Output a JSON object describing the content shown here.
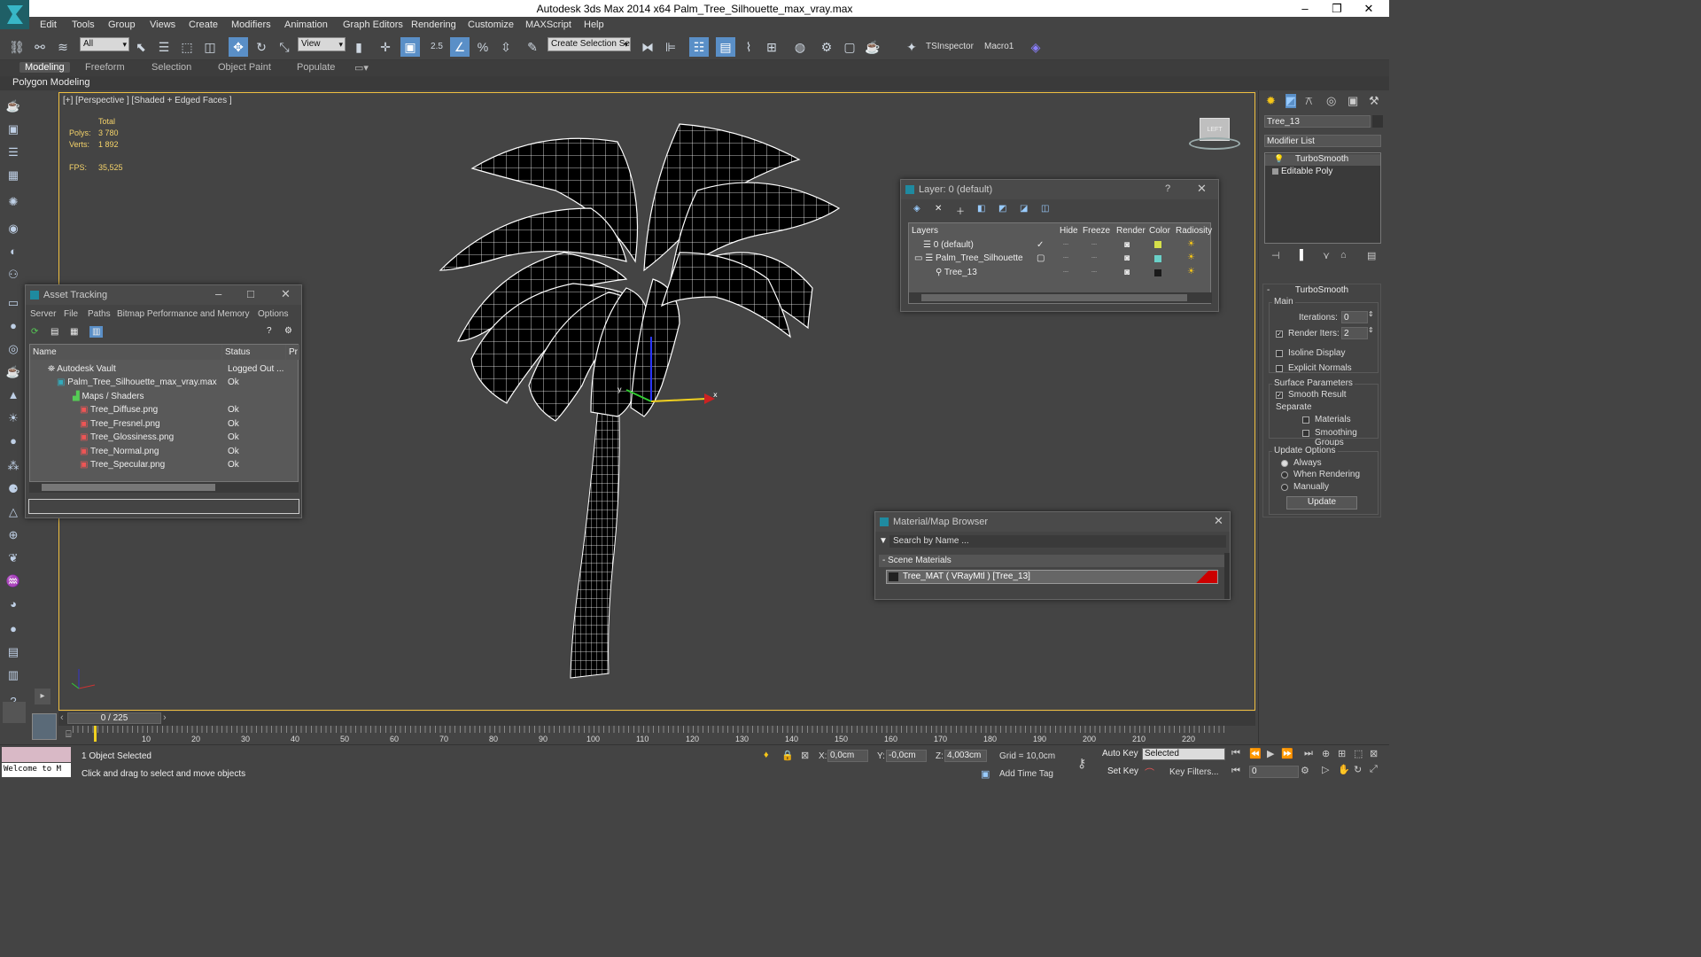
{
  "window": {
    "title": "Autodesk 3ds Max  2014 x64    Palm_Tree_Silhouette_max_vray.max",
    "minimize": "–",
    "maximize": "❐",
    "close": "✕"
  },
  "menu": [
    "Edit",
    "Tools",
    "Group",
    "Views",
    "Create",
    "Modifiers",
    "Animation",
    "Graph Editors",
    "Rendering",
    "Customize",
    "MAXScript",
    "Help"
  ],
  "toolbar": {
    "selection_filter": "All",
    "reference_coord": "View",
    "snap_value": "2.5",
    "named_selection": "Create Selection Se",
    "tsinspector": "TSInspector",
    "macro": "Macro1"
  },
  "ribbon": {
    "tabs": [
      "Modeling",
      "Freeform",
      "Selection",
      "Object Paint",
      "Populate"
    ],
    "active_tab": "Modeling",
    "panel_label": "Polygon Modeling"
  },
  "viewport": {
    "label": "[+] [Perspective ] [Shaded + Edged Faces ]",
    "stats_total": "Total",
    "polys_label": "Polys:",
    "polys_value": "3 780",
    "verts_label": "Verts:",
    "verts_value": "1 892",
    "fps_label": "FPS:",
    "fps_value": "35,525",
    "viewcube_label": "LEFT"
  },
  "asset_tracking": {
    "title": "Asset Tracking",
    "menu": [
      "Server",
      "File",
      "Paths",
      "Bitmap Performance and Memory",
      "Options"
    ],
    "columns": [
      "Name",
      "Status",
      "Pr"
    ],
    "rows": [
      {
        "name": "Autodesk Vault",
        "status": "Logged Out ..."
      },
      {
        "name": "Palm_Tree_Silhouette_max_vray.max",
        "status": "Ok"
      },
      {
        "name": "Maps / Shaders",
        "status": ""
      },
      {
        "name": "Tree_Diffuse.png",
        "status": "Ok"
      },
      {
        "name": "Tree_Fresnel.png",
        "status": "Ok"
      },
      {
        "name": "Tree_Glossiness.png",
        "status": "Ok"
      },
      {
        "name": "Tree_Normal.png",
        "status": "Ok"
      },
      {
        "name": "Tree_Specular.png",
        "status": "Ok"
      }
    ]
  },
  "layer_manager": {
    "title": "Layer: 0 (default)",
    "help": "?",
    "columns": [
      "Layers",
      "Hide",
      "Freeze",
      "Render",
      "Color",
      "Radiosity"
    ],
    "rows": [
      {
        "name": "0 (default)",
        "color": "#d6e04a"
      },
      {
        "name": "Palm_Tree_Silhouette",
        "color": "#6ad0c8"
      },
      {
        "name": "Tree_13",
        "color": "#1a1a1a"
      }
    ]
  },
  "material_browser": {
    "title": "Material/Map Browser",
    "search_placeholder": "Search by Name ...",
    "section": "- Scene Materials",
    "material": "Tree_MAT  ( VRayMtl )  [Tree_13]"
  },
  "command_panel": {
    "object_name": "Tree_13",
    "modifier_list": "Modifier List",
    "stack": [
      "TurboSmooth",
      "Editable Poly"
    ],
    "rollout_title": "TurboSmooth",
    "main_label": "Main",
    "iterations_label": "Iterations:",
    "iterations_value": "0",
    "render_iters_label": "Render Iters:",
    "render_iters_value": "2",
    "isoline": "Isoline Display",
    "explicit_normals": "Explicit Normals",
    "surface_params": "Surface Parameters",
    "smooth_result": "Smooth Result",
    "separate": "Separate",
    "materials": "Materials",
    "smoothing_groups": "Smoothing Groups",
    "update_options": "Update Options",
    "always": "Always",
    "when_rendering": "When Rendering",
    "manually": "Manually",
    "update_button": "Update"
  },
  "timeline": {
    "frame": "0 / 225",
    "ticks": [
      "10",
      "20",
      "30",
      "40",
      "50",
      "60",
      "70",
      "80",
      "90",
      "100",
      "110",
      "120",
      "130",
      "140",
      "150",
      "160",
      "170",
      "180",
      "190",
      "200",
      "210",
      "220"
    ]
  },
  "status": {
    "welcome": "Welcome to M",
    "selected": "1 Object Selected",
    "prompt": "Click and drag to select and move objects",
    "x_label": "X:",
    "x_value": "0,0cm",
    "y_label": "Y:",
    "y_value": "-0,0cm",
    "z_label": "Z:",
    "z_value": "4,003cm",
    "grid": "Grid = 10,0cm",
    "add_time_tag": "Add Time Tag",
    "auto_key": "Auto Key",
    "set_key": "Set Key",
    "key_mode": "Selected",
    "key_filters": "Key Filters...",
    "frame_value": "0"
  }
}
